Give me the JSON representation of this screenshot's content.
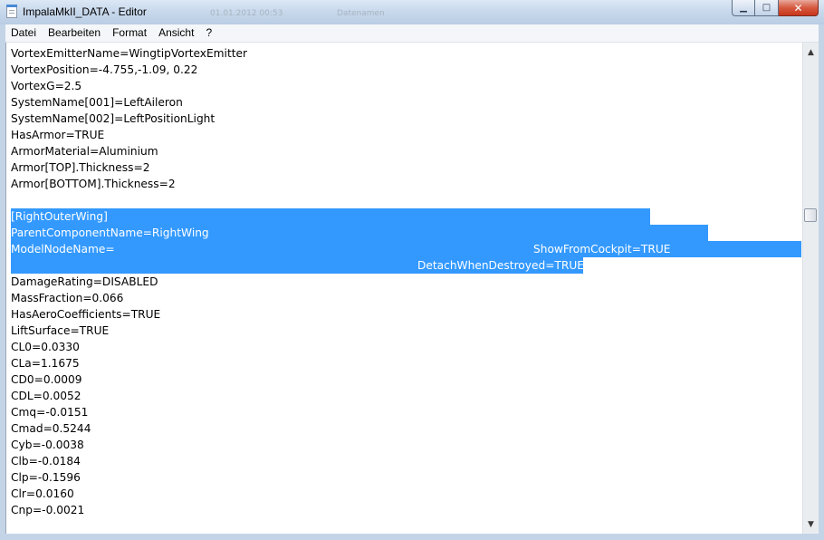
{
  "window": {
    "title": "ImpalaMkII_DATA - Editor",
    "background_fragments": [
      "01.01.2012 00:53",
      "Datenamen"
    ]
  },
  "menu": [
    "Datei",
    "Bearbeiten",
    "Format",
    "Ansicht",
    "?"
  ],
  "caption_buttons": {
    "minimize": "minimize-icon",
    "maximize": "maximize-icon",
    "close": "close-icon"
  },
  "editor": {
    "lines": [
      "VortexEmitterName=WingtipVortexEmitter",
      "VortexPosition=-4.755,-1.09, 0.22",
      "VortexG=2.5",
      "SystemName[001]=LeftAileron",
      "SystemName[002]=LeftPositionLight",
      "HasArmor=TRUE",
      "ArmorMaterial=Aluminium",
      "Armor[TOP].Thickness=2",
      "Armor[BOTTOM].Thickness=2",
      "",
      "[RightOuterWing]",
      "ParentComponentName=RightWing",
      "ModelNodeName=",
      "",
      "DamageRating=DISABLED",
      "MassFraction=0.066",
      "HasAeroCoefficients=TRUE",
      "LiftSurface=TRUE",
      "CL0=0.0330",
      "CLa=1.1675",
      "CD0=0.0009",
      "CDL=0.0052",
      "Cmq=-0.0151",
      "Cmad=0.5244",
      "Cyb=-0.0038",
      "Clb=-0.0184",
      "Clp=-0.1596",
      "Clr=0.0160",
      "Cnp=-0.0021"
    ],
    "selection_extra": {
      "show_from_cockpit": "ShowFromCockpit=TRUE",
      "detach_when_destroyed": "DetachWhenDestroyed=TRUE"
    }
  },
  "colors": {
    "selection": "#3399ff",
    "selected_text": "#ffffff",
    "close_button": "#c8361c"
  }
}
